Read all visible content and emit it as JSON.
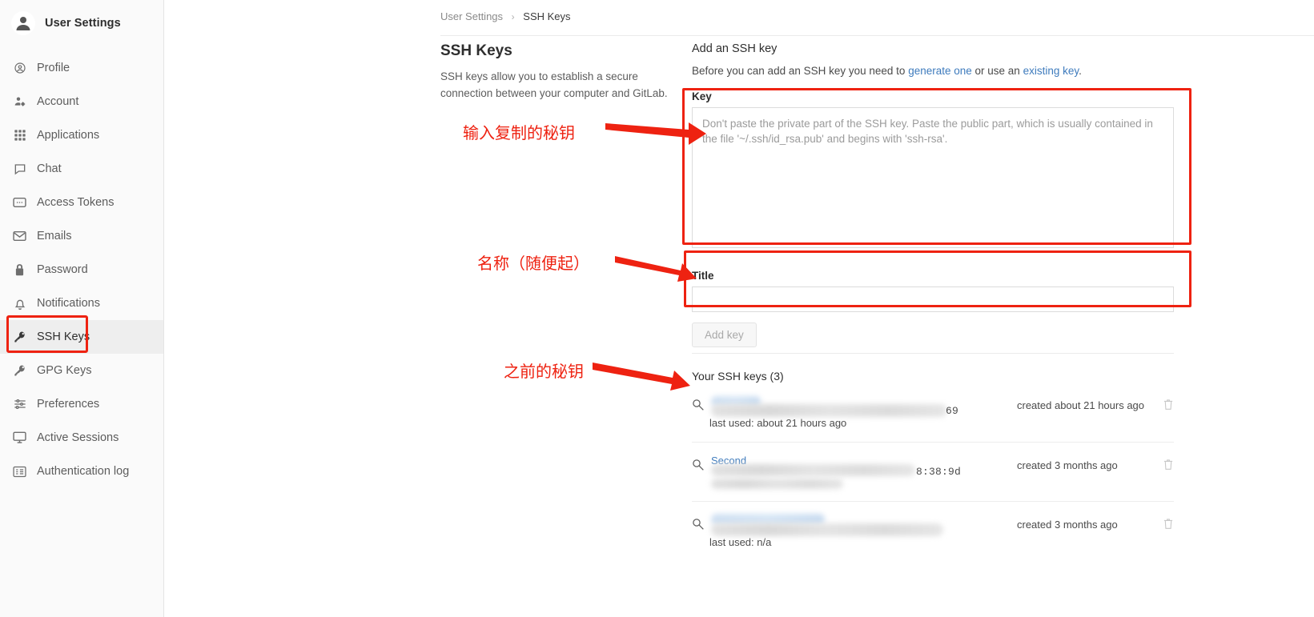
{
  "sidebar": {
    "header_title": "User Settings",
    "avatar_icon": "user-avatar-icon",
    "items": [
      {
        "label": "Profile",
        "icon": "user-circle-icon"
      },
      {
        "label": "Account",
        "icon": "user-gear-icon"
      },
      {
        "label": "Applications",
        "icon": "grid-apps-icon"
      },
      {
        "label": "Chat",
        "icon": "chat-bubble-icon"
      },
      {
        "label": "Access Tokens",
        "icon": "token-card-icon"
      },
      {
        "label": "Emails",
        "icon": "envelope-icon"
      },
      {
        "label": "Password",
        "icon": "lock-icon"
      },
      {
        "label": "Notifications",
        "icon": "bell-icon"
      },
      {
        "label": "SSH Keys",
        "icon": "key-icon",
        "active": true
      },
      {
        "label": "GPG Keys",
        "icon": "key-icon"
      },
      {
        "label": "Preferences",
        "icon": "sliders-icon"
      },
      {
        "label": "Active Sessions",
        "icon": "monitor-icon"
      },
      {
        "label": "Authentication log",
        "icon": "log-list-icon"
      }
    ]
  },
  "breadcrumb": {
    "parent": "User Settings",
    "separator": "›",
    "current": "SSH Keys"
  },
  "description": {
    "heading": "SSH Keys",
    "body": "SSH keys allow you to establish a secure connection between your computer and GitLab."
  },
  "form": {
    "heading": "Add an SSH key",
    "intro_prefix": "Before you can add an SSH key you need to ",
    "link_generate": "generate one",
    "intro_middle": " or use an ",
    "link_existing": "existing key",
    "intro_suffix": ".",
    "key_label": "Key",
    "key_placeholder": "Don't paste the private part of the SSH key. Paste the public part, which is usually contained in the file '~/.ssh/id_rsa.pub' and begins with 'ssh-rsa'.",
    "key_value": "",
    "title_label": "Title",
    "title_value": "",
    "title_placeholder": "",
    "submit_label": "Add key"
  },
  "keys_list": {
    "heading": "Your SSH keys (3)",
    "rows": [
      {
        "name": "",
        "fingerprint_visible_tail": "69",
        "last_used": "last used: about 21 hours ago",
        "created": "created about 21 hours ago",
        "delete_icon": "trash-icon",
        "key_icon": "key-icon",
        "redacted": true
      },
      {
        "name": "Second",
        "fingerprint_visible_tail": "8:38:9d",
        "last_used": "",
        "created": "created 3 months ago",
        "delete_icon": "trash-icon",
        "key_icon": "key-icon",
        "redacted": true
      },
      {
        "name": "",
        "fingerprint_visible_tail": "",
        "last_used": "last used: n/a",
        "created": "created 3 months ago",
        "delete_icon": "trash-icon",
        "key_icon": "key-icon",
        "redacted": true
      }
    ]
  },
  "annotations": {
    "accent_color": "#ee2211",
    "note_key": "输入复制的秘钥",
    "note_title": "名称（随便起）",
    "note_keys_list": "之前的秘钥"
  }
}
